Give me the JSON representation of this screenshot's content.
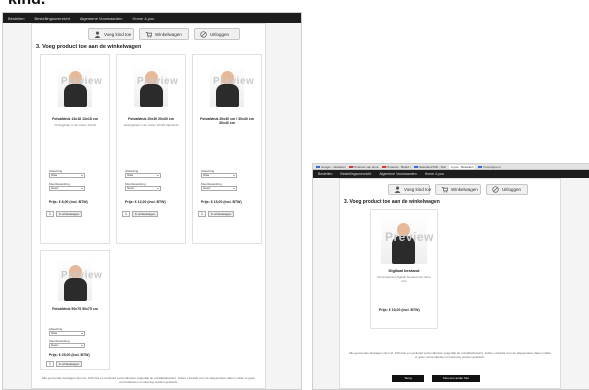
{
  "caption": "kind.",
  "left": {
    "nav": [
      "Bestellen",
      "Bestellingsoverzicht",
      "Algemene Voorwaarden",
      "Home 4-you"
    ],
    "toolbar": {
      "add_child": "Voeg kind toe",
      "cart": "Winkelwagen",
      "logout": "Uitloggen"
    },
    "section_title": "3. Voeg product toe aan de winkelwagen",
    "watermark": "Preview",
    "products": [
      {
        "title": "Fotoafdruk 13x18 13x18 cm",
        "desc": "Verkrijgbaar in de maten 13x18",
        "price": "Prijs: € 8,00 (incl. BTW)"
      },
      {
        "title": "Fotoafdruk 20x30 20x30 cm",
        "desc": "Verkrijgbaar in de maten 20x30 afgedrukt",
        "price": "Prijs: € 12,00 (incl. BTW)"
      },
      {
        "title": "Fotoafdruk 30x40 cm / 30x40 cm 30x40 cm",
        "desc": "",
        "price": "Prijs: € 15,00 (incl. BTW)"
      },
      {
        "title": "Fotoafdruk 50x75 50x75 cm",
        "desc": "",
        "price": "Prijs: € 25,00 (incl. BTW)"
      }
    ],
    "fields": {
      "finish_label": "Afwerking",
      "finish_value": "Glas",
      "color_label": "Kleurbewerking",
      "color_value": "Geen",
      "qty": "1",
      "add_button": "In winkelwagen"
    },
    "footer_note": "Alle genoemde bedragen zijn incl. 21% btw en exclusief verzendkosten (eigenlijk de ontwikkelkosten). Indien u bestelt voor de afgesproken datum zullen er geen verzendkosten in rekening worden gebracht."
  },
  "right": {
    "browser_tabs": [
      "Google - Nederlan",
      "Pinterest van anna",
      "Pinterest - Board i",
      "Nederland MN - Sub",
      "4-you - Bestellen",
      "home4you.nl"
    ],
    "nav": [
      "Bestellen",
      "Bestellingsoverzicht",
      "Algemene Voorwaarden",
      "Home 4-you"
    ],
    "toolbar": {
      "add_child": "Voeg kind toe",
      "cart": "Winkelwagen",
      "logout": "Uitloggen"
    },
    "section_title": "3. Voeg product toe aan de winkelwagen",
    "watermark": "Preview",
    "product": {
      "title": "Digitaal bestand",
      "desc": "Download het digitale bestand van deze foto",
      "price": "Prijs: € 15,00 (incl. BTW)"
    },
    "footer_note": "Alle genoemde bedragen zijn incl. 21% btw en exclusief verzendkosten (eigenlijk de ontwikkelkosten). Indien u bestelt voor de afgesproken datum zullen er geen verzendkosten in rekening worden gebracht.",
    "buttons": {
      "back": "Terug",
      "next": "Kies een ander foto"
    }
  }
}
